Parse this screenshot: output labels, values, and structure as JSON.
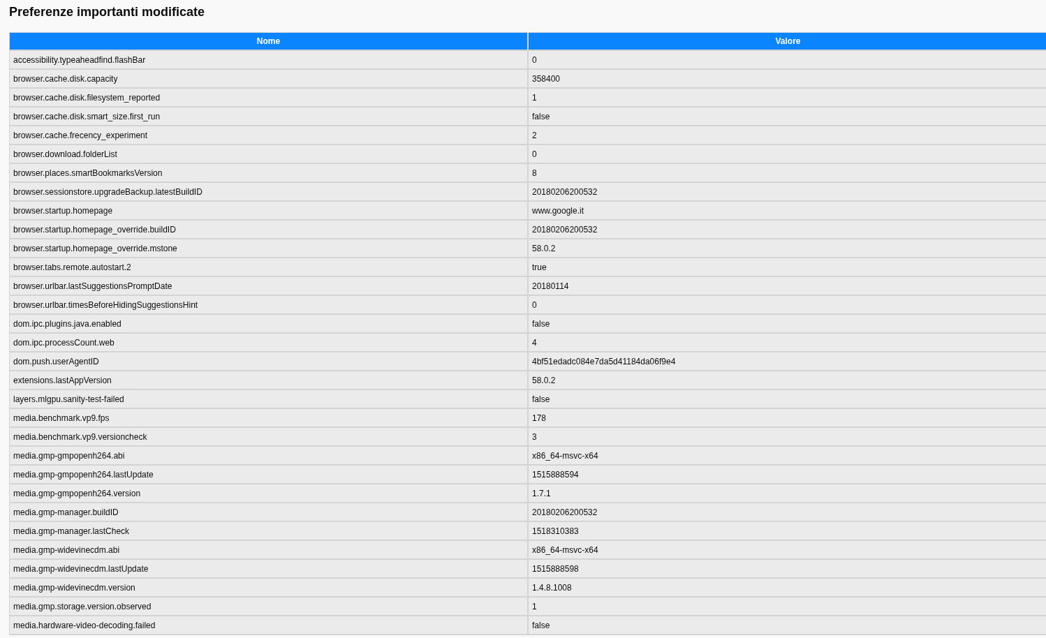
{
  "title": "Preferenze importanti modificate",
  "table": {
    "columns": [
      "Nome",
      "Valore"
    ],
    "rows": [
      [
        "accessibility.typeaheadfind.flashBar",
        "0"
      ],
      [
        "browser.cache.disk.capacity",
        "358400"
      ],
      [
        "browser.cache.disk.filesystem_reported",
        "1"
      ],
      [
        "browser.cache.disk.smart_size.first_run",
        "false"
      ],
      [
        "browser.cache.frecency_experiment",
        "2"
      ],
      [
        "browser.download.folderList",
        "0"
      ],
      [
        "browser.places.smartBookmarksVersion",
        "8"
      ],
      [
        "browser.sessionstore.upgradeBackup.latestBuildID",
        "20180206200532"
      ],
      [
        "browser.startup.homepage",
        "www.google.it"
      ],
      [
        "browser.startup.homepage_override.buildID",
        "20180206200532"
      ],
      [
        "browser.startup.homepage_override.mstone",
        "58.0.2"
      ],
      [
        "browser.tabs.remote.autostart.2",
        "true"
      ],
      [
        "browser.urlbar.lastSuggestionsPromptDate",
        "20180114"
      ],
      [
        "browser.urlbar.timesBeforeHidingSuggestionsHint",
        "0"
      ],
      [
        "dom.ipc.plugins.java.enabled",
        "false"
      ],
      [
        "dom.ipc.processCount.web",
        "4"
      ],
      [
        "dom.push.userAgentID",
        "4bf51edadc084e7da5d41184da06f9e4"
      ],
      [
        "extensions.lastAppVersion",
        "58.0.2"
      ],
      [
        "layers.mlgpu.sanity-test-failed",
        "false"
      ],
      [
        "media.benchmark.vp9.fps",
        "178"
      ],
      [
        "media.benchmark.vp9.versioncheck",
        "3"
      ],
      [
        "media.gmp-gmpopenh264.abi",
        "x86_64-msvc-x64"
      ],
      [
        "media.gmp-gmpopenh264.lastUpdate",
        "1515888594"
      ],
      [
        "media.gmp-gmpopenh264.version",
        "1.7.1"
      ],
      [
        "media.gmp-manager.buildID",
        "20180206200532"
      ],
      [
        "media.gmp-manager.lastCheck",
        "1518310383"
      ],
      [
        "media.gmp-widevinecdm.abi",
        "x86_64-msvc-x64"
      ],
      [
        "media.gmp-widevinecdm.lastUpdate",
        "1515888598"
      ],
      [
        "media.gmp-widevinecdm.version",
        "1.4.8.1008"
      ],
      [
        "media.gmp.storage.version.observed",
        "1"
      ],
      [
        "media.hardware-video-decoding.failed",
        "false"
      ]
    ]
  }
}
